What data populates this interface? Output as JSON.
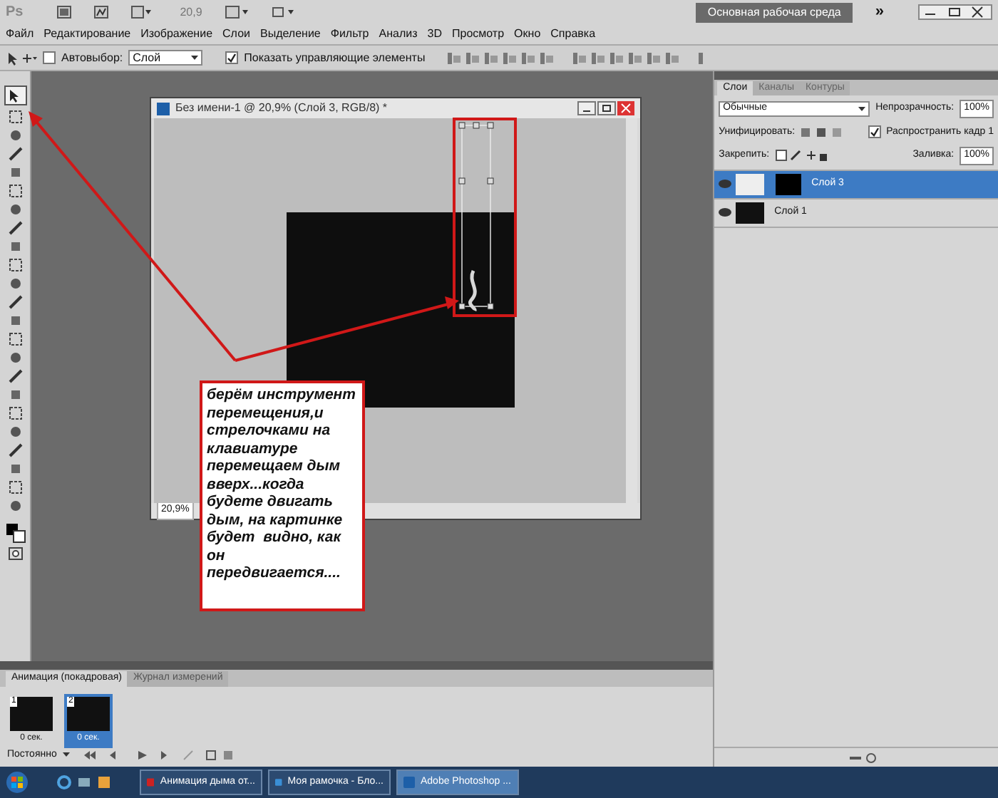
{
  "app_bar": {
    "logo": "Ps",
    "zoom": "20,9",
    "workspace_button": "Основная рабочая среда",
    "more": "»"
  },
  "menu": [
    "Файл",
    "Редактирование",
    "Изображение",
    "Слои",
    "Выделение",
    "Фильтр",
    "Анализ",
    "3D",
    "Просмотр",
    "Окно",
    "Справка"
  ],
  "options_bar": {
    "auto_select": {
      "label": "Автовыбор:",
      "checked": false
    },
    "auto_select_target": "Слой",
    "show_controls": {
      "label": "Показать управляющие элементы",
      "checked": true
    }
  },
  "document": {
    "title": "Без имени-1 @ 20,9% (Слой 3, RGB/8) *",
    "zoom": "20,9%"
  },
  "annotation": {
    "text": "берём инструмент перемещения,и стрелочками на клавиатуре перемещаем дым вверх...когда будете двигать дым, на картинке будет  видно, как он передвигается...."
  },
  "layers_panel": {
    "tabs": [
      {
        "label": "Слои",
        "selected": true
      },
      {
        "label": "Каналы",
        "selected": false
      },
      {
        "label": "Контуры",
        "selected": false
      }
    ],
    "blend_mode": "Обычные",
    "opacity_label": "Непрозрачность:",
    "opacity": "100%",
    "unify_label": "Унифицировать:",
    "propagate": {
      "label": "Распространить кадр 1",
      "checked": true
    },
    "lock_label": "Закрепить:",
    "fill_label": "Заливка:",
    "fill": "100%",
    "layers": [
      {
        "name": "Слой 3",
        "selected": true
      },
      {
        "name": "Слой 1",
        "selected": false
      }
    ]
  },
  "animation_panel": {
    "tabs": [
      {
        "label": "Анимация (покадровая)",
        "selected": true
      },
      {
        "label": "Журнал измерений",
        "selected": false
      }
    ],
    "frames": [
      {
        "number": "1",
        "delay": "0 сек.",
        "selected": false
      },
      {
        "number": "2",
        "delay": "0 сек.",
        "selected": true
      }
    ],
    "loop": "Постоянно"
  },
  "taskbar": {
    "items": [
      {
        "label": "Анимация дыма от...",
        "selected": false
      },
      {
        "label": "Моя рамочка - Бло...",
        "selected": false
      },
      {
        "label": "Adobe Photoshop ...",
        "selected": true
      }
    ]
  }
}
